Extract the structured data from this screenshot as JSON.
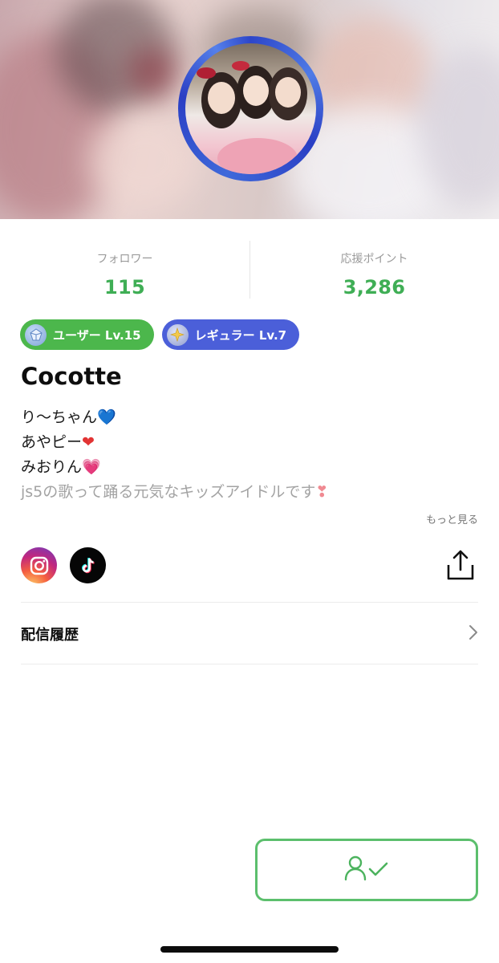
{
  "stats": {
    "followers_label": "フォロワー",
    "followers_value": "115",
    "points_label": "応援ポイント",
    "points_value": "3,286"
  },
  "badges": [
    {
      "label": "ユーザー Lv.15",
      "icon": "gem-icon",
      "color": "#4cb74c"
    },
    {
      "label": "レギュラー Lv.7",
      "icon": "sparkle-icon",
      "color": "#4b5fd9"
    }
  ],
  "profile": {
    "name": "Cocotte",
    "bio_lines": [
      {
        "text": "り〜ちゃん",
        "emoji": "💙"
      },
      {
        "text": "あやピー",
        "emoji": "❤"
      },
      {
        "text": "みおりん",
        "emoji": "💗"
      },
      {
        "text": "js5の歌って踊る元気なキッズアイドルです",
        "emoji": "❣"
      }
    ],
    "more_label": "もっと見る"
  },
  "social": {
    "instagram_icon": "instagram-icon",
    "tiktok_icon": "tiktok-icon",
    "share_icon": "share-icon"
  },
  "history": {
    "label": "配信履歴"
  },
  "follow_button": {
    "icon": "followed-user-check-icon",
    "color": "#5cbf6d"
  },
  "colors": {
    "accent_green": "#3fae55",
    "badge_user": "#4cb74c",
    "badge_regular": "#4b5fd9",
    "avatar_ring": "#2d46c9"
  }
}
